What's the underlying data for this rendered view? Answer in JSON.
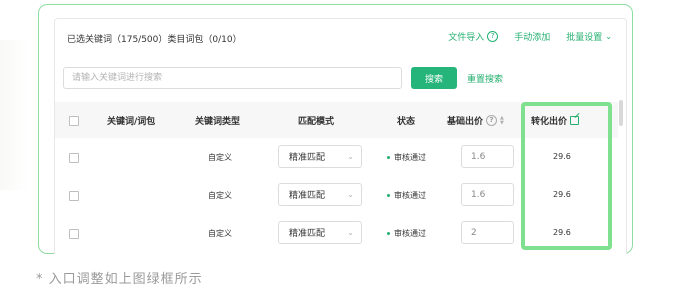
{
  "header": {
    "title": "已选关键词（175/500）类目词包（0/10）",
    "actions": {
      "import": "文件导入",
      "manual_add": "手动添加",
      "batch_settings": "批量设置"
    }
  },
  "search": {
    "placeholder": "请输入关键词进行搜索",
    "button_label": "搜索",
    "reset_label": "重置搜索"
  },
  "table": {
    "columns": {
      "keyword": "关键词/词包",
      "keyword_type": "关键词类型",
      "match_mode": "匹配模式",
      "status": "状态",
      "base_bid": "基础出价",
      "conversion_bid": "转化出价"
    },
    "rows": [
      {
        "type": "自定义",
        "match": "精准匹配",
        "status": "审核通过",
        "base_bid": "1.6",
        "conversion_bid": "29.6"
      },
      {
        "type": "自定义",
        "match": "精准匹配",
        "status": "审核通过",
        "base_bid": "1.6",
        "conversion_bid": "29.6"
      },
      {
        "type": "自定义",
        "match": "精准匹配",
        "status": "审核通过",
        "base_bid": "2",
        "conversion_bid": "29.6"
      }
    ]
  },
  "footnote": "* 入口调整如上图绿框所示",
  "colors": {
    "accent": "#25b070",
    "highlight_border": "#7fe08f",
    "outer_border": "#8fdca3"
  }
}
